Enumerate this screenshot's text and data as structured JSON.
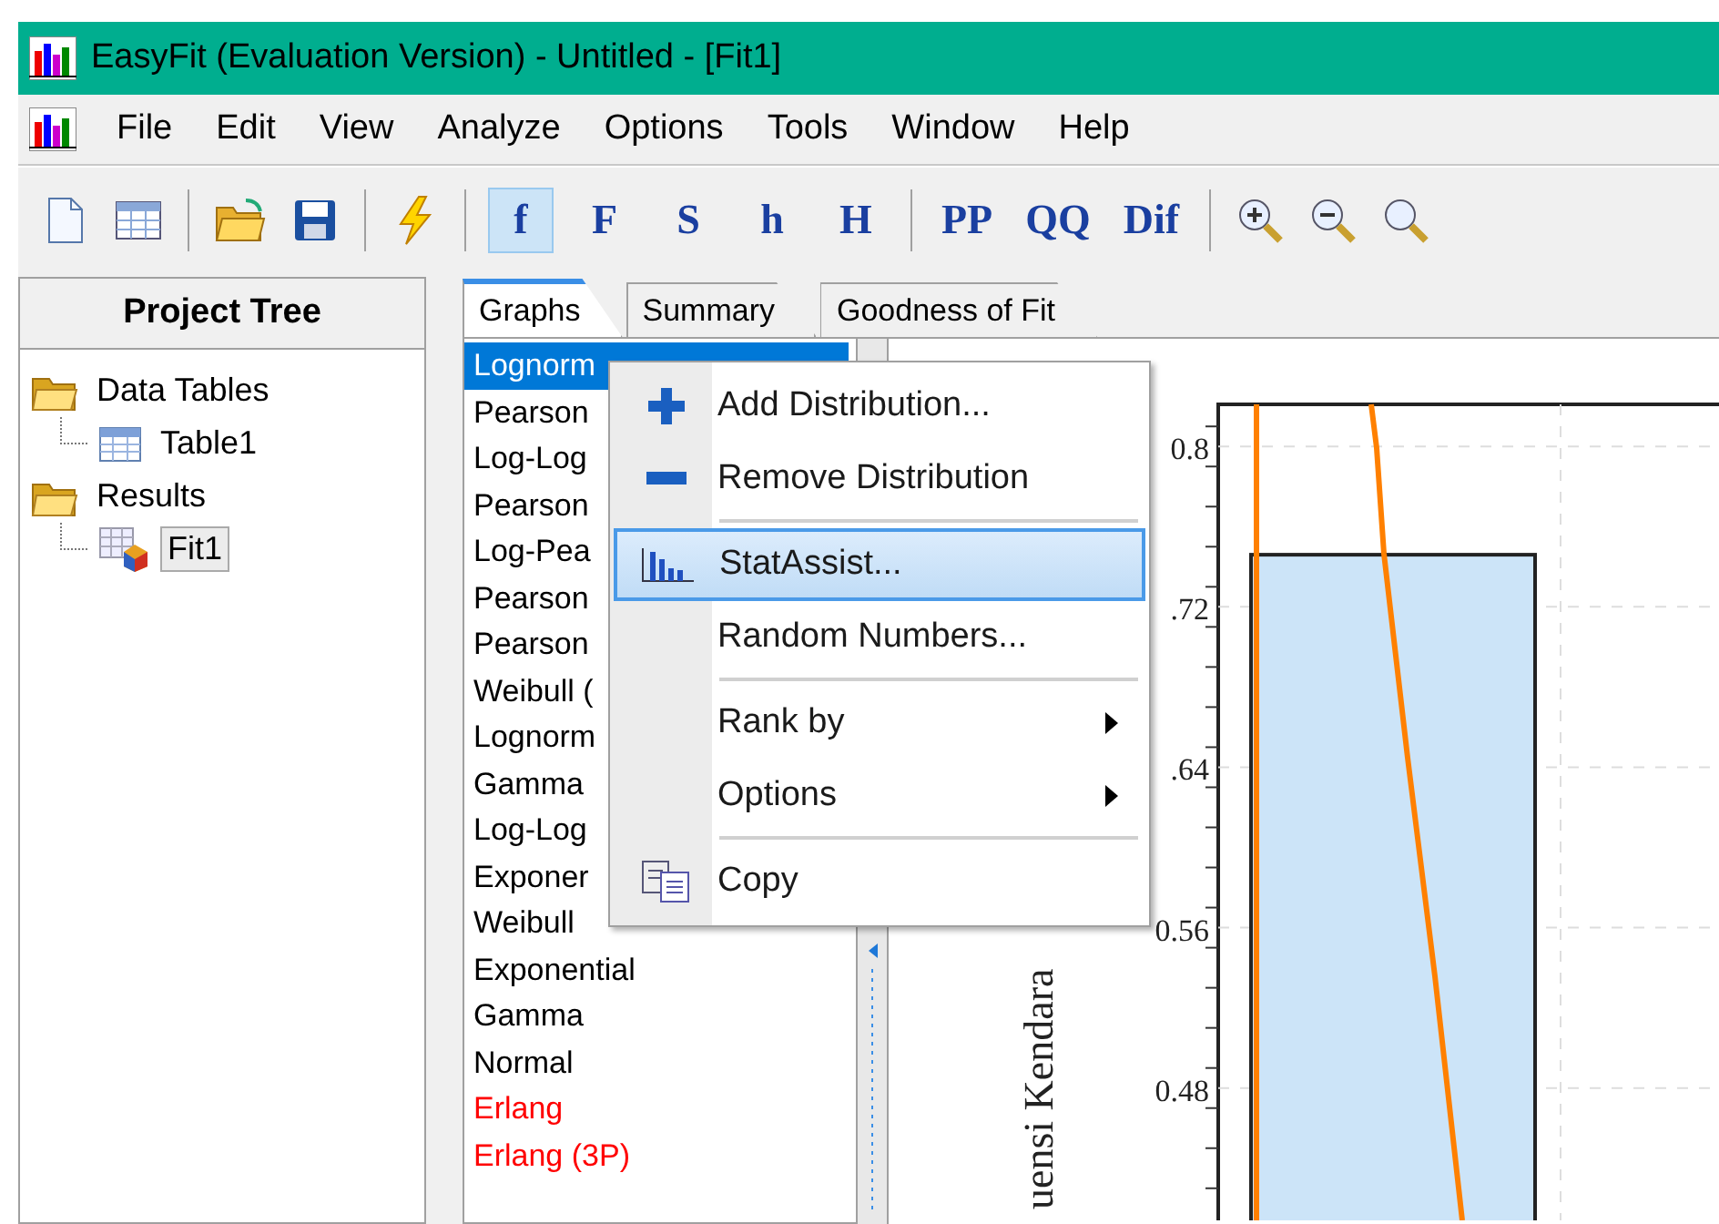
{
  "window": {
    "title": "EasyFit (Evaluation Version) - Untitled - [Fit1]"
  },
  "menu_bar": [
    "File",
    "Edit",
    "View",
    "Analyze",
    "Options",
    "Tools",
    "Window",
    "Help"
  ],
  "toolbar": {
    "text_buttons": [
      {
        "label": "f",
        "selected": true
      },
      {
        "label": "F",
        "selected": false
      },
      {
        "label": "S",
        "selected": false
      },
      {
        "label": "h",
        "selected": false
      },
      {
        "label": "H",
        "selected": false
      },
      {
        "label": "PP",
        "selected": false
      },
      {
        "label": "QQ",
        "selected": false
      },
      {
        "label": "Dif",
        "selected": false
      }
    ]
  },
  "project_tree": {
    "title": "Project Tree",
    "items": [
      {
        "label": "Data Tables",
        "kind": "folder",
        "selected": false,
        "children": [
          {
            "label": "Table1",
            "kind": "table",
            "selected": false
          }
        ]
      },
      {
        "label": "Results",
        "kind": "folder",
        "selected": false,
        "children": [
          {
            "label": "Fit1",
            "kind": "fit",
            "selected": true
          }
        ]
      }
    ]
  },
  "tabs": [
    {
      "label": "Graphs",
      "selected": true
    },
    {
      "label": "Summary",
      "selected": false
    },
    {
      "label": "Goodness of Fit",
      "selected": false
    }
  ],
  "distributions": [
    {
      "label": "Lognorm",
      "selected": true
    },
    {
      "label": "Pearson",
      "selected": false,
      "color": "#000000"
    },
    {
      "label": "Log-Log",
      "selected": false,
      "color": "#000000"
    },
    {
      "label": "Pearson",
      "selected": false,
      "color": "#000000"
    },
    {
      "label": "Log-Pea",
      "selected": false,
      "color": "#000000"
    },
    {
      "label": "Pearson",
      "selected": false,
      "color": "#000000"
    },
    {
      "label": "Pearson",
      "selected": false,
      "color": "#000000"
    },
    {
      "label": "Weibull (",
      "selected": false,
      "color": "#000000"
    },
    {
      "label": "Lognorm",
      "selected": false,
      "color": "#000000"
    },
    {
      "label": "Gamma",
      "selected": false,
      "color": "#000000"
    },
    {
      "label": "Log-Log",
      "selected": false,
      "color": "#000000"
    },
    {
      "label": "Exponer",
      "selected": false,
      "color": "#000000"
    },
    {
      "label": "Weibull",
      "selected": false,
      "color": "#000000"
    },
    {
      "label": "Exponential",
      "selected": false,
      "color": "#000000"
    },
    {
      "label": "Gamma",
      "selected": false,
      "color": "#000000"
    },
    {
      "label": "Normal",
      "selected": false,
      "color": "#000000"
    },
    {
      "label": "Erlang",
      "selected": false,
      "color": "#ff0000"
    },
    {
      "label": "Erlang (3P)",
      "selected": false,
      "color": "#ff0000"
    }
  ],
  "context_menu": [
    {
      "kind": "item",
      "label": "Add Distribution...",
      "selected": false
    },
    {
      "kind": "item",
      "label": "Remove Distribution",
      "selected": false
    },
    {
      "kind": "separator"
    },
    {
      "kind": "item",
      "label": "StatAssist...",
      "selected": true
    },
    {
      "kind": "item",
      "label": "Random Numbers...",
      "selected": false
    },
    {
      "kind": "separator"
    },
    {
      "kind": "submenu",
      "label": "Rank by",
      "selected": false
    },
    {
      "kind": "submenu",
      "label": "Options",
      "selected": false
    },
    {
      "kind": "separator"
    },
    {
      "kind": "item",
      "label": "Copy",
      "selected": false
    }
  ],
  "graph": {
    "chart_data": {
      "type": "bar",
      "ylabel": "uensi Kendara",
      "values": [
        0.746
      ],
      "ylim": [
        0.414,
        0.821
      ],
      "grid": true,
      "yticks": [
        {
          "value": 0.48,
          "label": "0.48"
        },
        {
          "value": 0.56,
          "label": "0.56"
        },
        {
          "value": 0.64,
          "label": ".64"
        },
        {
          "value": 0.72,
          "label": ".72"
        },
        {
          "value": 0.8,
          "label": "0.8"
        }
      ]
    }
  }
}
